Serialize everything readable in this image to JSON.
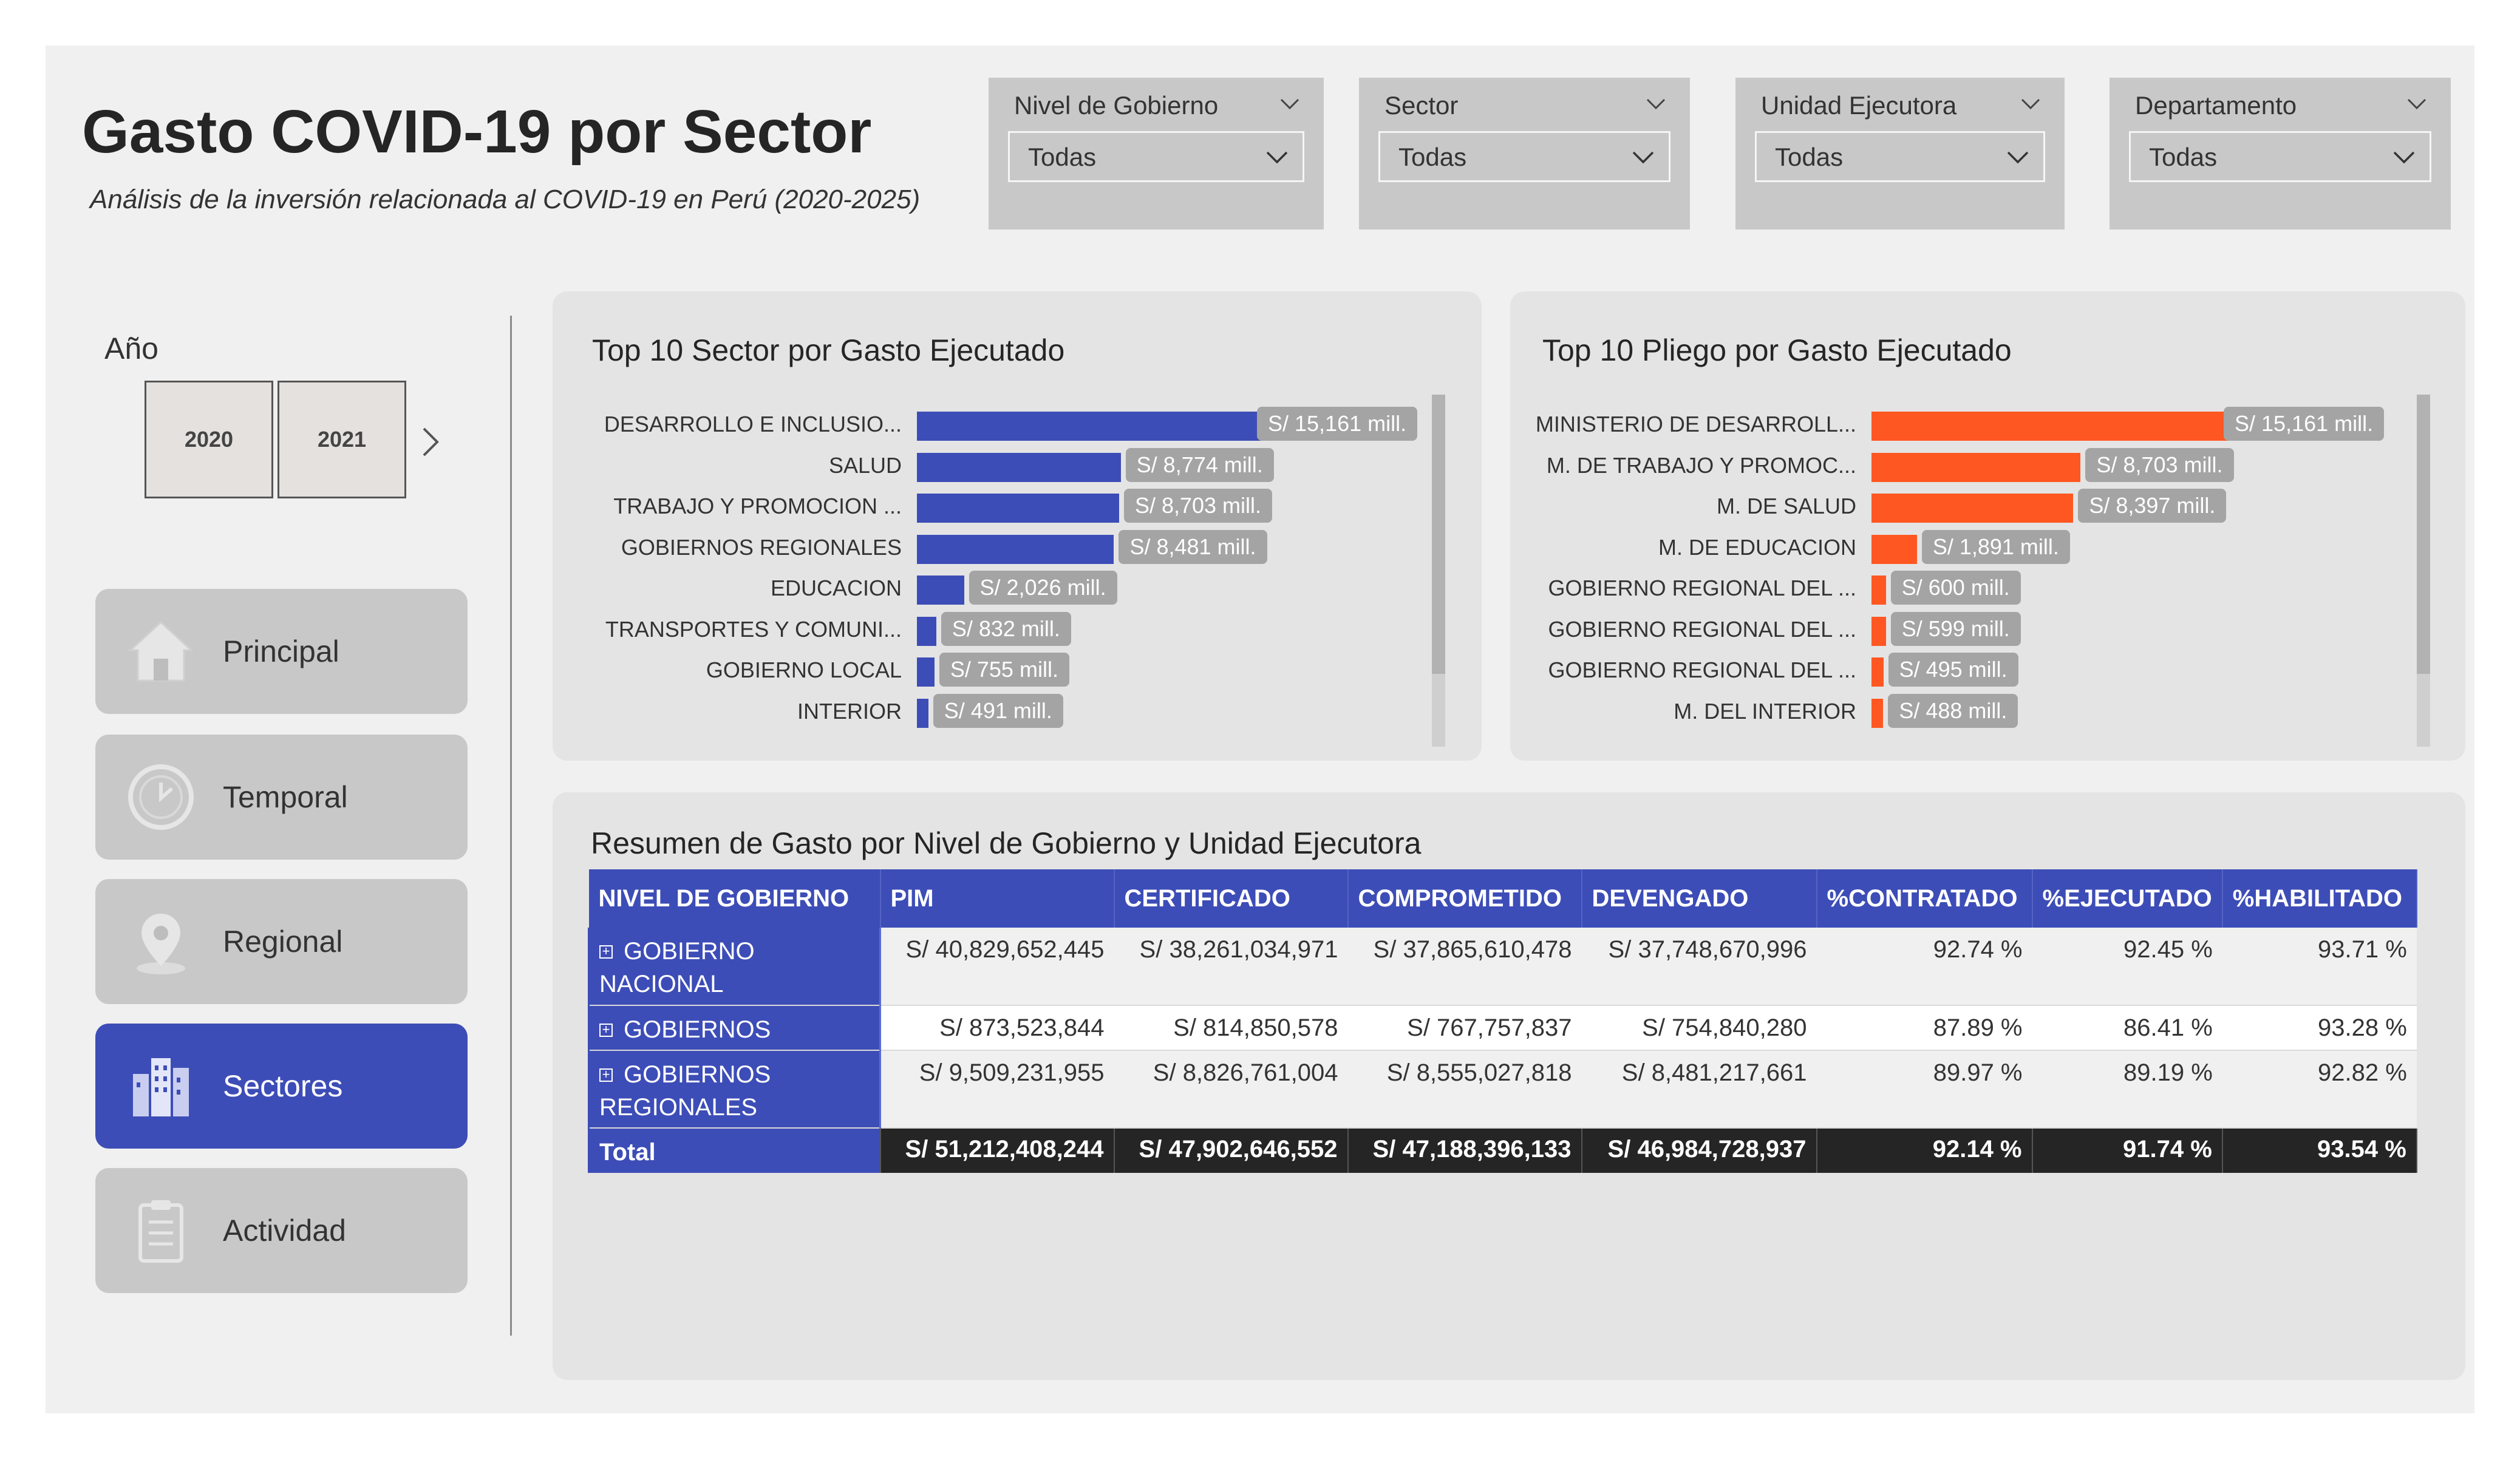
{
  "header": {
    "title": "Gasto COVID-19 por Sector",
    "subtitle": "Análisis de la inversión relacionada al COVID-19 en Perú (2020-2025)"
  },
  "filters": [
    {
      "label": "Nivel de Gobierno",
      "value": "Todas"
    },
    {
      "label": "Sector",
      "value": "Todas"
    },
    {
      "label": "Unidad Ejecutora",
      "value": "Todas"
    },
    {
      "label": "Departamento",
      "value": "Todas"
    }
  ],
  "year_slicer": {
    "label": "Año",
    "years": [
      "2020",
      "2021"
    ]
  },
  "nav": [
    {
      "label": "Principal",
      "icon": "home-icon",
      "active": false
    },
    {
      "label": "Temporal",
      "icon": "clock-icon",
      "active": false
    },
    {
      "label": "Regional",
      "icon": "map-pin-icon",
      "active": false
    },
    {
      "label": "Sectores",
      "icon": "buildings-icon",
      "active": true
    },
    {
      "label": "Actividad",
      "icon": "clipboard-icon",
      "active": false
    }
  ],
  "colors": {
    "accent": "#3d4db7",
    "sector_bar": "#3d4db7",
    "pliego_bar": "#ff5722",
    "panel": "#e4e4e4",
    "total_row": "#252525"
  },
  "chart_data": [
    {
      "type": "bar",
      "orientation": "horizontal",
      "title": "Top 10 Sector por Gasto Ejecutado",
      "categories": [
        "DESARROLLO E INCLUSIO...",
        "SALUD",
        "TRABAJO Y PROMOCION ...",
        "GOBIERNOS REGIONALES",
        "EDUCACION",
        "TRANSPORTES Y COMUNI...",
        "GOBIERNO LOCAL",
        "INTERIOR"
      ],
      "values": [
        15161,
        8774,
        8703,
        8481,
        2026,
        832,
        755,
        491
      ],
      "labels": [
        "S/ 15,161 mill.",
        "S/ 8,774 mill.",
        "S/ 8,703 mill.",
        "S/ 8,481 mill.",
        "S/ 2,026 mill.",
        "S/ 832 mill.",
        "S/ 755 mill.",
        "S/ 491 mill."
      ],
      "color": "#3d4db7"
    },
    {
      "type": "bar",
      "orientation": "horizontal",
      "title": "Top 10 Pliego por Gasto Ejecutado",
      "categories": [
        "MINISTERIO DE DESARROLL...",
        "M. DE TRABAJO Y PROMOC...",
        "M. DE SALUD",
        "M. DE EDUCACION",
        "GOBIERNO REGIONAL DEL ...",
        "GOBIERNO REGIONAL DEL ...",
        "GOBIERNO REGIONAL DEL ...",
        "M. DEL INTERIOR"
      ],
      "values": [
        15161,
        8703,
        8397,
        1891,
        600,
        599,
        495,
        488
      ],
      "labels": [
        "S/ 15,161 mill.",
        "S/ 8,703 mill.",
        "S/ 8,397 mill.",
        "S/ 1,891 mill.",
        "S/ 600 mill.",
        "S/ 599 mill.",
        "S/ 495 mill.",
        "S/ 488 mill."
      ],
      "color": "#ff5722"
    }
  ],
  "summary_table": {
    "title": "Resumen de Gasto por Nivel de Gobierno y Unidad Ejecutora",
    "columns": [
      "NIVEL DE GOBIERNO",
      "PIM",
      "CERTIFICADO",
      "COMPROMETIDO",
      "DEVENGADO",
      "%CONTRATADO",
      "%EJECUTADO",
      "%HABILITADO"
    ],
    "rows": [
      {
        "nivel": "GOBIERNO NACIONAL",
        "pim": "S/ 40,829,652,445",
        "certificado": "S/ 38,261,034,971",
        "comprometido": "S/ 37,865,610,478",
        "devengado": "S/ 37,748,670,996",
        "contratado": "92.74 %",
        "ejecutado": "92.45 %",
        "habilitado": "93.71 %"
      },
      {
        "nivel": "GOBIERNOS",
        "pim": "S/ 873,523,844",
        "certificado": "S/ 814,850,578",
        "comprometido": "S/ 767,757,837",
        "devengado": "S/ 754,840,280",
        "contratado": "87.89 %",
        "ejecutado": "86.41 %",
        "habilitado": "93.28 %"
      },
      {
        "nivel": "GOBIERNOS REGIONALES",
        "pim": "S/ 9,509,231,955",
        "certificado": "S/ 8,826,761,004",
        "comprometido": "S/ 8,555,027,818",
        "devengado": "S/ 8,481,217,661",
        "contratado": "89.97 %",
        "ejecutado": "89.19 %",
        "habilitado": "92.82 %"
      }
    ],
    "total": {
      "nivel": "Total",
      "pim": "S/ 51,212,408,244",
      "certificado": "S/ 47,902,646,552",
      "comprometido": "S/ 47,188,396,133",
      "devengado": "S/ 46,984,728,937",
      "contratado": "92.14 %",
      "ejecutado": "91.74 %",
      "habilitado": "93.54 %"
    }
  }
}
